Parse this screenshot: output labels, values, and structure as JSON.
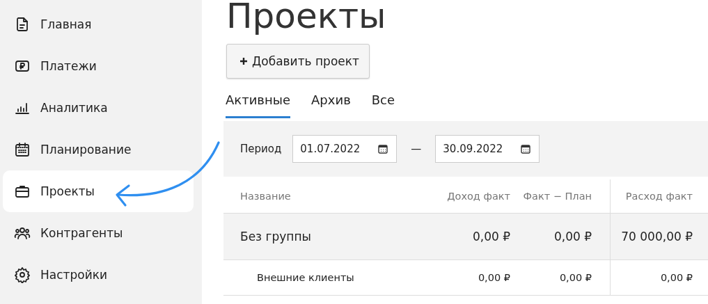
{
  "sidebar": {
    "items": [
      {
        "label": "Главная",
        "selected": false
      },
      {
        "label": "Платежи",
        "selected": false
      },
      {
        "label": "Аналитика",
        "selected": false
      },
      {
        "label": "Планирование",
        "selected": false
      },
      {
        "label": "Проекты",
        "selected": true
      },
      {
        "label": "Контрагенты",
        "selected": false
      },
      {
        "label": "Настройки",
        "selected": false
      }
    ]
  },
  "page": {
    "title": "Проекты",
    "add_button": "Добавить проект",
    "tabs": [
      {
        "label": "Активные",
        "selected": true
      },
      {
        "label": "Архив",
        "selected": false
      },
      {
        "label": "Все",
        "selected": false
      }
    ],
    "filter": {
      "label": "Период",
      "from": "01.07.2022",
      "separator": "—",
      "to": "30.09.2022"
    },
    "table": {
      "columns": [
        "Название",
        "Доход факт",
        "Факт − План",
        "Расход факт"
      ],
      "rows": [
        {
          "name": "Без группы",
          "income": "0,00 ₽",
          "diff": "0,00 ₽",
          "expense": "70 000,00 ₽",
          "children": [
            {
              "name": "Внешние клиенты",
              "income": "0,00 ₽",
              "diff": "0,00 ₽",
              "expense": "0,00 ₽"
            }
          ]
        }
      ]
    }
  }
}
